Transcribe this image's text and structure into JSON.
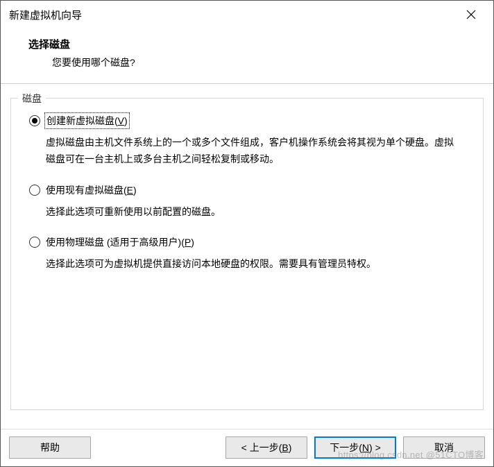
{
  "window": {
    "title": "新建虚拟机向导"
  },
  "header": {
    "heading": "选择磁盘",
    "subheading": "您要使用哪个磁盘?"
  },
  "fieldset": {
    "legend": "磁盘"
  },
  "options": {
    "create": {
      "label_pre": "创建新虚拟磁盘(",
      "mnemonic": "V",
      "label_post": ")",
      "description": "虚拟磁盘由主机文件系统上的一个或多个文件组成，客户机操作系统会将其视为单个硬盘。虚拟磁盘可在一台主机上或多台主机之间轻松复制或移动。",
      "selected": true
    },
    "existing": {
      "label_pre": "使用现有虚拟磁盘(",
      "mnemonic": "E",
      "label_post": ")",
      "description": "选择此选项可重新使用以前配置的磁盘。",
      "selected": false
    },
    "physical": {
      "label_pre": "使用物理磁盘 (适用于高级用户)(",
      "mnemonic": "P",
      "label_post": ")",
      "description": "选择此选项可为虚拟机提供直接访问本地硬盘的权限。需要具有管理员特权。",
      "selected": false
    }
  },
  "buttons": {
    "help": "帮助",
    "back_pre": "< 上一步(",
    "back_mn": "B",
    "back_post": ")",
    "next_pre": "下一步(",
    "next_mn": "N",
    "next_post": ") >",
    "cancel": "取消"
  },
  "watermark": "https://blog.csdn.net @51CTO博客"
}
